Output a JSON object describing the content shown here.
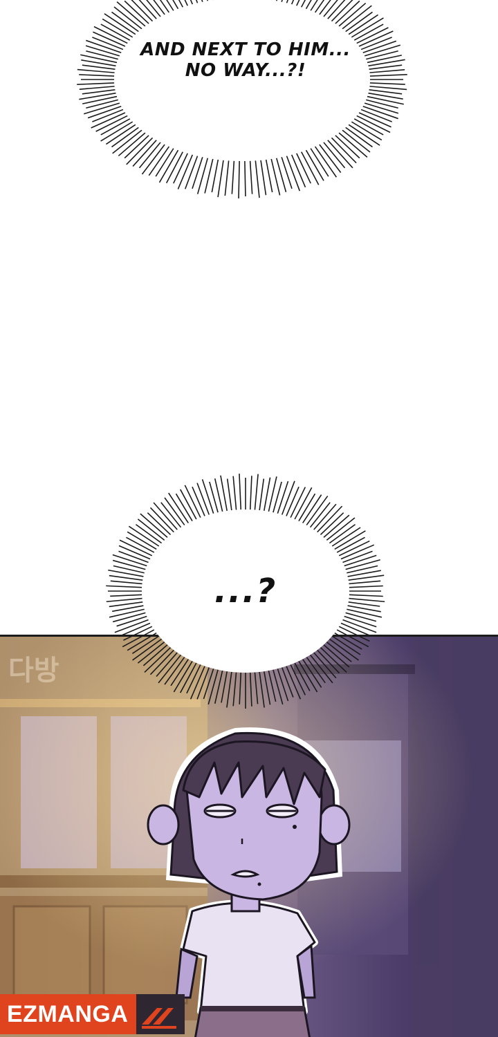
{
  "bubble_top": {
    "line1": "AND NEXT TO HIM...",
    "line2": "NO WAY...?!"
  },
  "bubble_bottom": {
    "text": "...?"
  },
  "watermark": {
    "label": "EZMANGA",
    "sign_text": "다방"
  },
  "colors": {
    "panel_warm": "#a88a64",
    "panel_cool": "#4c3d6a",
    "watermark_bg": "#e0441f"
  }
}
